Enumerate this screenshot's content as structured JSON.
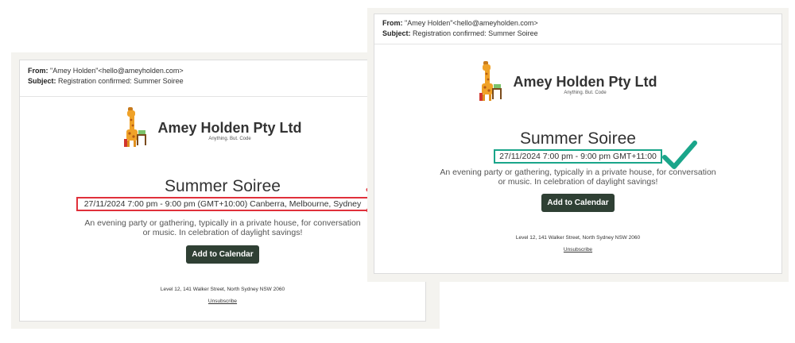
{
  "left_email": {
    "from_label": "From:",
    "from_value": "\"Amey Holden\"<hello@ameyholden.com>",
    "subject_label": "Subject:",
    "subject_value": "Registration confirmed: Summer Soiree",
    "brand_name": "Amey Holden Pty Ltd",
    "tagline": "Anything. But. Code",
    "event_title": "Summer Soiree",
    "event_datetime": "27/11/2024 7:00 pm - 9:00 pm (GMT+10:00) Canberra, Melbourne, Sydney",
    "description": "An evening party or gathering, typically in a private house, for conversation or music. In celebration of daylight savings!",
    "button_label": "Add to Calendar",
    "address": "Level 12, 141 Walker Street, North Sydney NSW 2060",
    "unsubscribe": "Unsubscribe"
  },
  "right_email": {
    "from_label": "From:",
    "from_value": "\"Amey Holden\"<hello@ameyholden.com>",
    "subject_label": "Subject:",
    "subject_value": "Registration confirmed: Summer Soiree",
    "brand_name": "Amey Holden Pty Ltd",
    "tagline": "Anything. But. Code",
    "event_title": "Summer Soiree",
    "event_datetime": "27/11/2024 7:00 pm - 9:00 pm GMT+11:00",
    "description": "An evening party or gathering, typically in a private house, for conversation or music. In celebration of daylight savings!",
    "button_label": "Add to Calendar",
    "address": "Level 12, 141 Walker Street, North Sydney NSW 2060",
    "unsubscribe": "Unsubscribe"
  },
  "colors": {
    "wrong_highlight": "#e0303a",
    "correct_highlight": "#1aa58a",
    "button_bg": "#2f4034",
    "frame_bg": "#f4f3ef"
  },
  "icons": {
    "wrong_mark": "cross-icon",
    "correct_mark": "checkmark-icon",
    "logo": "giraffe-logo-icon"
  }
}
